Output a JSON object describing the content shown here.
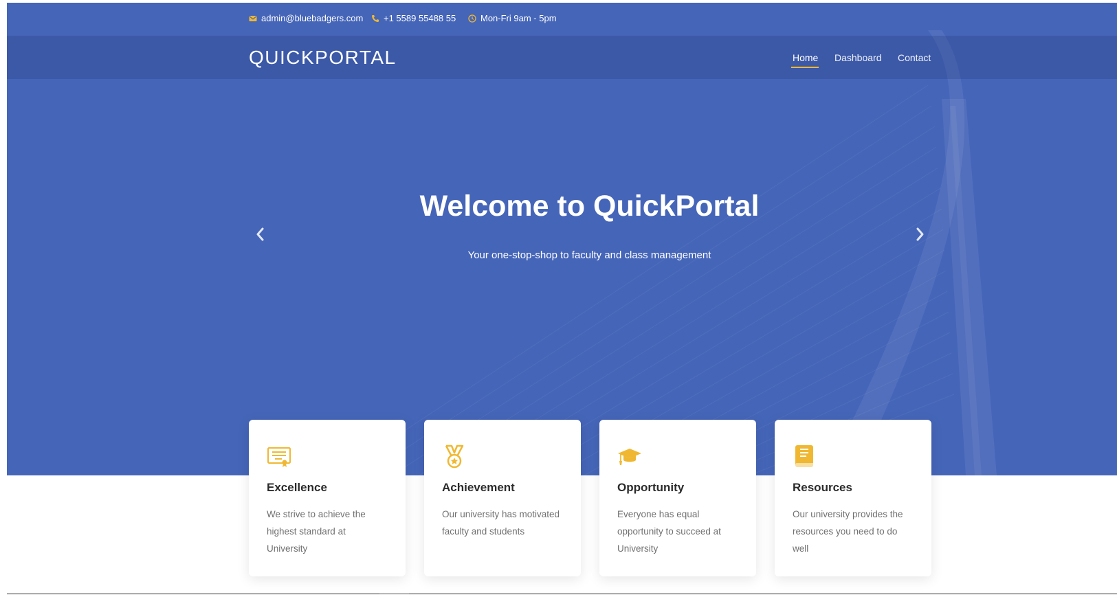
{
  "topbar": {
    "email": "admin@bluebadgers.com",
    "phone": "+1 5589 55488 55",
    "hours": "Mon-Fri 9am - 5pm"
  },
  "navbar": {
    "brand": "QUICKPORTAL",
    "links": [
      {
        "label": "Home",
        "active": true
      },
      {
        "label": "Dashboard",
        "active": false
      },
      {
        "label": "Contact",
        "active": false
      }
    ]
  },
  "hero": {
    "title": "Welcome to QuickPortal",
    "subtitle": "Your one-stop-shop to faculty and class management"
  },
  "cards": [
    {
      "icon": "certificate-icon",
      "title": "Excellence",
      "text": "We strive to achieve the highest standard at University"
    },
    {
      "icon": "medal-icon",
      "title": "Achievement",
      "text": "Our university has motivated faculty and students"
    },
    {
      "icon": "graduation-cap-icon",
      "title": "Opportunity",
      "text": "Everyone has equal opportunity to succeed at University"
    },
    {
      "icon": "book-icon",
      "title": "Resources",
      "text": "Our university provides the resources you need to do well"
    }
  ],
  "colors": {
    "hero_blue": "#4565b8",
    "accent": "#f0b832"
  }
}
